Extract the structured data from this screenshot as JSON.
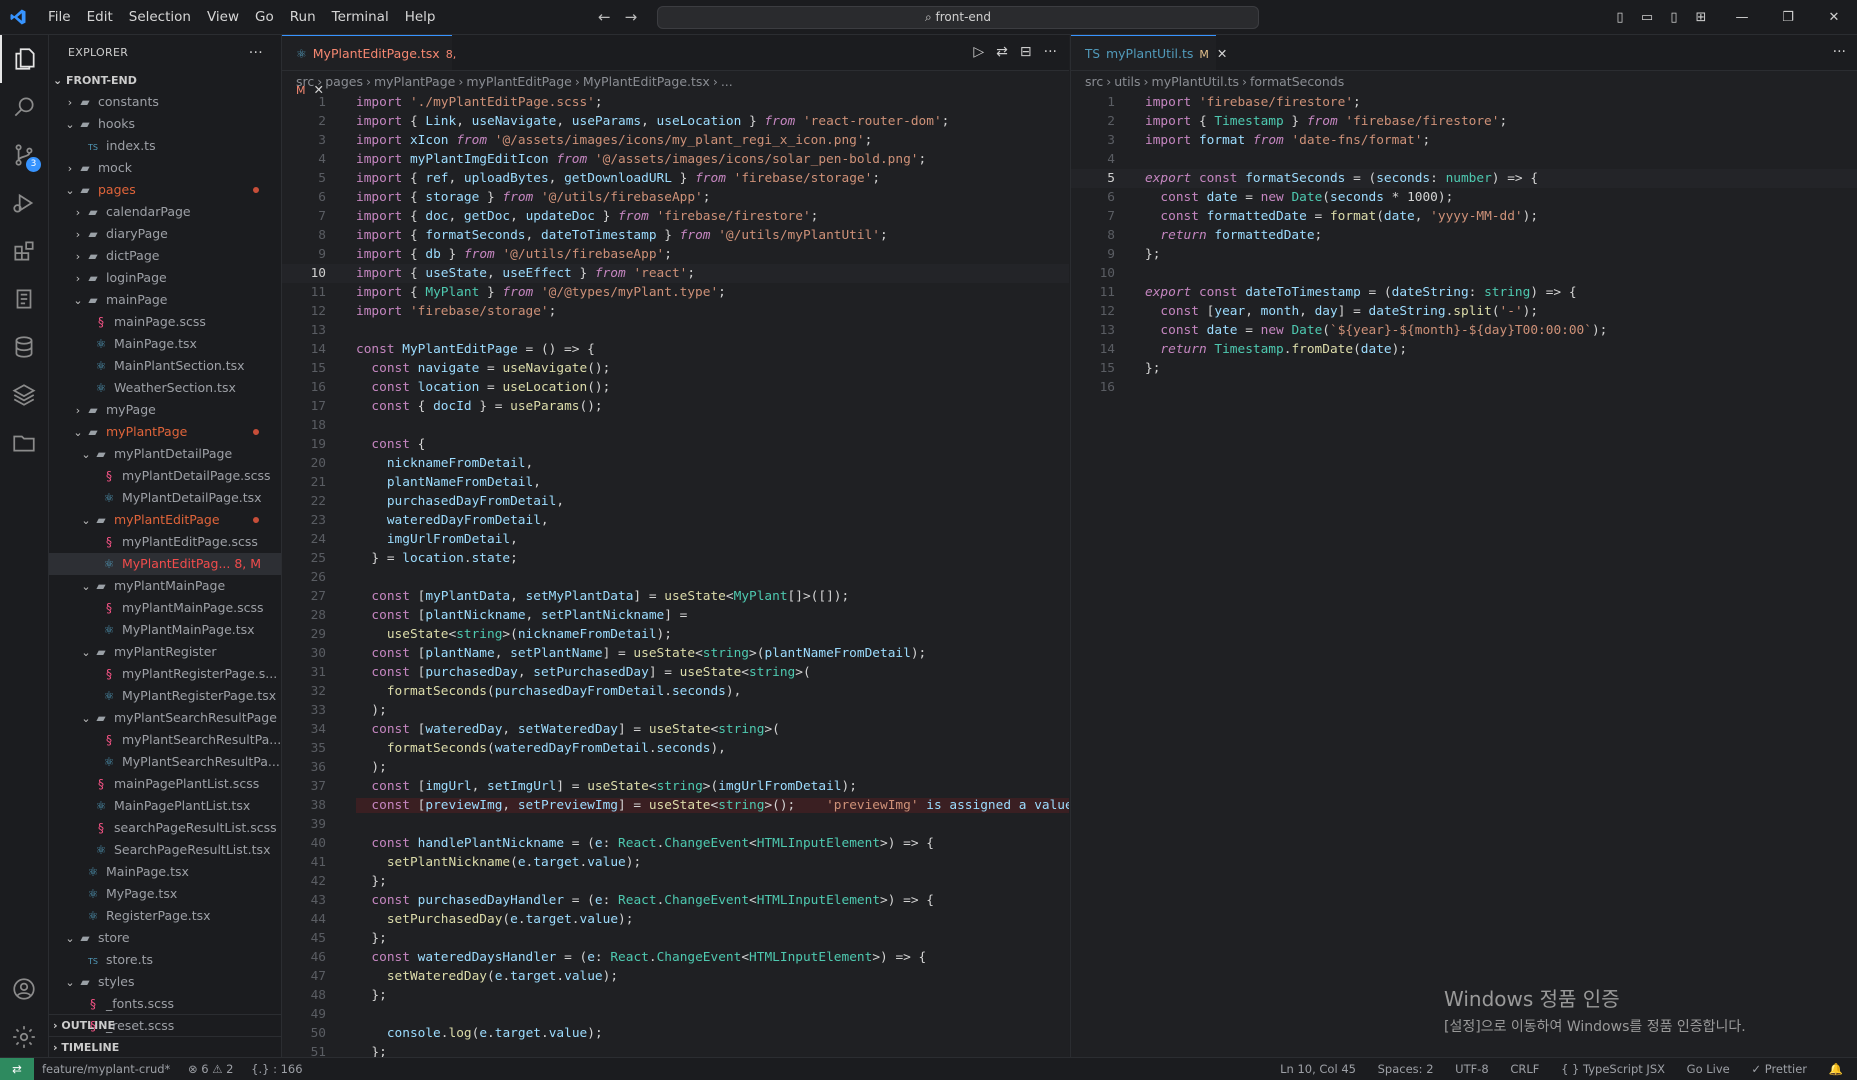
{
  "titlebar": {
    "menu": [
      "File",
      "Edit",
      "Selection",
      "View",
      "Go",
      "Run",
      "Terminal",
      "Help"
    ],
    "search_text": "front-end"
  },
  "sidebar": {
    "title": "EXPLORER",
    "more": "···",
    "root": "FRONT-END",
    "outline": "OUTLINE",
    "timeline": "TIMELINE"
  },
  "tree": [
    {
      "label": "constants",
      "depth": 1,
      "kind": "folder",
      "open": false
    },
    {
      "label": "hooks",
      "depth": 1,
      "kind": "folder",
      "open": true
    },
    {
      "label": "index.ts",
      "depth": 2,
      "kind": "ts"
    },
    {
      "label": "mock",
      "depth": 1,
      "kind": "folder",
      "open": false
    },
    {
      "label": "pages",
      "depth": 1,
      "kind": "folder",
      "open": true,
      "dot": true,
      "color": "#e0643a"
    },
    {
      "label": "calendarPage",
      "depth": 2,
      "kind": "folder",
      "open": false
    },
    {
      "label": "diaryPage",
      "depth": 2,
      "kind": "folder",
      "open": false
    },
    {
      "label": "dictPage",
      "depth": 2,
      "kind": "folder",
      "open": false
    },
    {
      "label": "loginPage",
      "depth": 2,
      "kind": "folder",
      "open": false
    },
    {
      "label": "mainPage",
      "depth": 2,
      "kind": "folder",
      "open": true
    },
    {
      "label": "mainPage.scss",
      "depth": 3,
      "kind": "scss"
    },
    {
      "label": "MainPage.tsx",
      "depth": 3,
      "kind": "tsx"
    },
    {
      "label": "MainPlantSection.tsx",
      "depth": 3,
      "kind": "tsx"
    },
    {
      "label": "WeatherSection.tsx",
      "depth": 3,
      "kind": "tsx"
    },
    {
      "label": "myPage",
      "depth": 2,
      "kind": "folder",
      "open": false
    },
    {
      "label": "myPlantPage",
      "depth": 2,
      "kind": "folder",
      "open": true,
      "dot": true,
      "color": "#e0643a"
    },
    {
      "label": "myPlantDetailPage",
      "depth": 3,
      "kind": "folder",
      "open": true
    },
    {
      "label": "myPlantDetailPage.scss",
      "depth": 4,
      "kind": "scss"
    },
    {
      "label": "MyPlantDetailPage.tsx",
      "depth": 4,
      "kind": "tsx"
    },
    {
      "label": "myPlantEditPage",
      "depth": 3,
      "kind": "folder",
      "open": true,
      "dot": true,
      "color": "#e0643a"
    },
    {
      "label": "myPlantEditPage.scss",
      "depth": 4,
      "kind": "scss"
    },
    {
      "label": "MyPlantEditPag... 8, M",
      "depth": 4,
      "kind": "tsx",
      "selected": true,
      "color": "#f14c4c"
    },
    {
      "label": "myPlantMainPage",
      "depth": 3,
      "kind": "folder",
      "open": true
    },
    {
      "label": "myPlantMainPage.scss",
      "depth": 4,
      "kind": "scss"
    },
    {
      "label": "MyPlantMainPage.tsx",
      "depth": 4,
      "kind": "tsx"
    },
    {
      "label": "myPlantRegister",
      "depth": 3,
      "kind": "folder",
      "open": true
    },
    {
      "label": "myPlantRegisterPage.s...",
      "depth": 4,
      "kind": "scss"
    },
    {
      "label": "MyPlantRegisterPage.tsx",
      "depth": 4,
      "kind": "tsx"
    },
    {
      "label": "myPlantSearchResultPage",
      "depth": 3,
      "kind": "folder",
      "open": true
    },
    {
      "label": "myPlantSearchResultPa...",
      "depth": 4,
      "kind": "scss"
    },
    {
      "label": "MyPlantSearchResultPa...",
      "depth": 4,
      "kind": "tsx"
    },
    {
      "label": "mainPagePlantList.scss",
      "depth": 3,
      "kind": "scss"
    },
    {
      "label": "MainPagePlantList.tsx",
      "depth": 3,
      "kind": "tsx"
    },
    {
      "label": "searchPageResultList.scss",
      "depth": 3,
      "kind": "scss"
    },
    {
      "label": "SearchPageResultList.tsx",
      "depth": 3,
      "kind": "tsx"
    },
    {
      "label": "MainPage.tsx",
      "depth": 2,
      "kind": "tsx"
    },
    {
      "label": "MyPage.tsx",
      "depth": 2,
      "kind": "tsx"
    },
    {
      "label": "RegisterPage.tsx",
      "depth": 2,
      "kind": "tsx"
    },
    {
      "label": "store",
      "depth": 1,
      "kind": "folder",
      "open": true
    },
    {
      "label": "store.ts",
      "depth": 2,
      "kind": "ts"
    },
    {
      "label": "styles",
      "depth": 1,
      "kind": "folder",
      "open": true
    },
    {
      "label": "_fonts.scss",
      "depth": 2,
      "kind": "scss"
    },
    {
      "label": "_reset.scss",
      "depth": 2,
      "kind": "scss"
    }
  ],
  "editor1": {
    "tab_label": "MyPlantEditPage.tsx",
    "tab_mod": "8, M",
    "tab_color": "#f48771",
    "breadcrumb": [
      "src",
      "pages",
      "myPlantPage",
      "myPlantEditPage",
      "MyPlantEditPage.tsx",
      "..."
    ],
    "current_line": 10,
    "error_line": 38,
    "lines": [
      "import './myPlantEditPage.scss';",
      "import { Link, useNavigate, useParams, useLocation } from 'react-router-dom';",
      "import xIcon from '@/assets/images/icons/my_plant_regi_x_icon.png';",
      "import myPlantImgEditIcon from '@/assets/images/icons/solar_pen-bold.png';",
      "import { ref, uploadBytes, getDownloadURL } from 'firebase/storage';",
      "import { storage } from '@/utils/firebaseApp';",
      "import { doc, getDoc, updateDoc } from 'firebase/firestore';",
      "import { formatSeconds, dateToTimestamp } from '@/utils/myPlantUtil';",
      "import { db } from '@/utils/firebaseApp';",
      "import { useState, useEffect } from 'react';",
      "import { MyPlant } from '@/@types/myPlant.type';",
      "import 'firebase/storage';",
      "",
      "const MyPlantEditPage = () => {",
      "  const navigate = useNavigate();",
      "  const location = useLocation();",
      "  const { docId } = useParams();",
      "",
      "  const {",
      "    nicknameFromDetail,",
      "    plantNameFromDetail,",
      "    purchasedDayFromDetail,",
      "    wateredDayFromDetail,",
      "    imgUrlFromDetail,",
      "  } = location.state;",
      "",
      "  const [myPlantData, setMyPlantData] = useState<MyPlant[]>([]);",
      "  const [plantNickname, setPlantNickname] =",
      "    useState<string>(nicknameFromDetail);",
      "  const [plantName, setPlantName] = useState<string>(plantNameFromDetail);",
      "  const [purchasedDay, setPurchasedDay] = useState<string>(",
      "    formatSeconds(purchasedDayFromDetail.seconds),",
      "  );",
      "  const [wateredDay, setWateredDay] = useState<string>(",
      "    formatSeconds(wateredDayFromDetail.seconds),",
      "  );",
      "  const [imgUrl, setImgUrl] = useState<string>(imgUrlFromDetail);",
      "  const [previewImg, setPreviewImg] = useState<string>();    'previewImg' is assigned a value",
      "",
      "  const handlePlantNickname = (e: React.ChangeEvent<HTMLInputElement>) => {",
      "    setPlantNickname(e.target.value);",
      "  };",
      "  const purchasedDayHandler = (e: React.ChangeEvent<HTMLInputElement>) => {",
      "    setPurchasedDay(e.target.value);",
      "  };",
      "  const wateredDaysHandler = (e: React.ChangeEvent<HTMLInputElement>) => {",
      "    setWateredDay(e.target.value);",
      "  };",
      "",
      "    console.log(e.target.value);",
      "  };",
      ""
    ]
  },
  "editor2": {
    "tab_label": "myPlantUtil.ts",
    "tab_mod": "M",
    "tab_color": "#519aba",
    "breadcrumb": [
      "src",
      "utils",
      "myPlantUtil.ts",
      "formatSeconds"
    ],
    "current_line": 5,
    "lines": [
      "import 'firebase/firestore';",
      "import { Timestamp } from 'firebase/firestore';",
      "import format from 'date-fns/format';",
      "",
      "export const formatSeconds = (seconds: number) => {",
      "  const date = new Date(seconds * 1000);",
      "  const formattedDate = format(date, 'yyyy-MM-dd');",
      "  return formattedDate;",
      "};",
      "",
      "export const dateToTimestamp = (dateString: string) => {",
      "  const [year, month, day] = dateString.split('-');",
      "  const date = new Date(`${year}-${month}-${day}T00:00:00`);",
      "  return Timestamp.fromDate(date);",
      "};",
      ""
    ]
  },
  "statusbar": {
    "branch": "feature/myplant-crud*",
    "problems": "⊗ 6 ⚠ 2",
    "ports": "{.} : 166",
    "position": "Ln 10, Col 45",
    "spaces": "Spaces: 2",
    "encoding": "UTF-8",
    "eol": "CRLF",
    "language": "{ } TypeScript JSX",
    "golive": "Go Live",
    "prettier": "✓ Prettier"
  },
  "watermark": {
    "line1": "Windows 정품 인증",
    "line2": "[설정]으로 이동하여 Windows를 정품 인증합니다."
  },
  "colors": {
    "keyword": "#c586c0",
    "string": "#ce9178",
    "function": "#dcdcaa",
    "type": "#4ec9b0",
    "variable": "#9cdcfe",
    "accent": "#3794ff"
  }
}
